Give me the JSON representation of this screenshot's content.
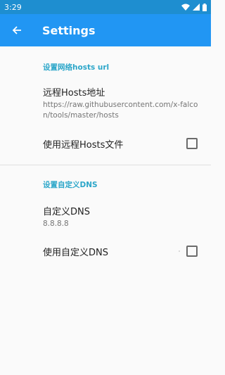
{
  "status_bar": {
    "time": "3:29"
  },
  "toolbar": {
    "title": "Settings"
  },
  "sections": [
    {
      "header": "设置网络hosts url",
      "remote_hosts": {
        "title": "远程Hosts地址",
        "summary": "https://raw.githubusercontent.com/x-falcon/tools/master/hosts"
      },
      "use_remote_hosts": {
        "title": "使用远程Hosts文件",
        "checked": false
      }
    },
    {
      "header": "设置自定义DNS",
      "custom_dns": {
        "title": "自定义DNS",
        "summary": "8.8.8.8"
      },
      "use_custom_dns": {
        "title": "使用自定义DNS",
        "checked": false
      }
    }
  ],
  "colors": {
    "status_bar": "#1e8ed0",
    "toolbar": "#2196f3",
    "accent": "#2ba6c9"
  },
  "icons": {
    "back": "arrow-left-icon",
    "wifi": "wifi-icon",
    "signal": "signal-icon",
    "battery": "battery-icon"
  }
}
